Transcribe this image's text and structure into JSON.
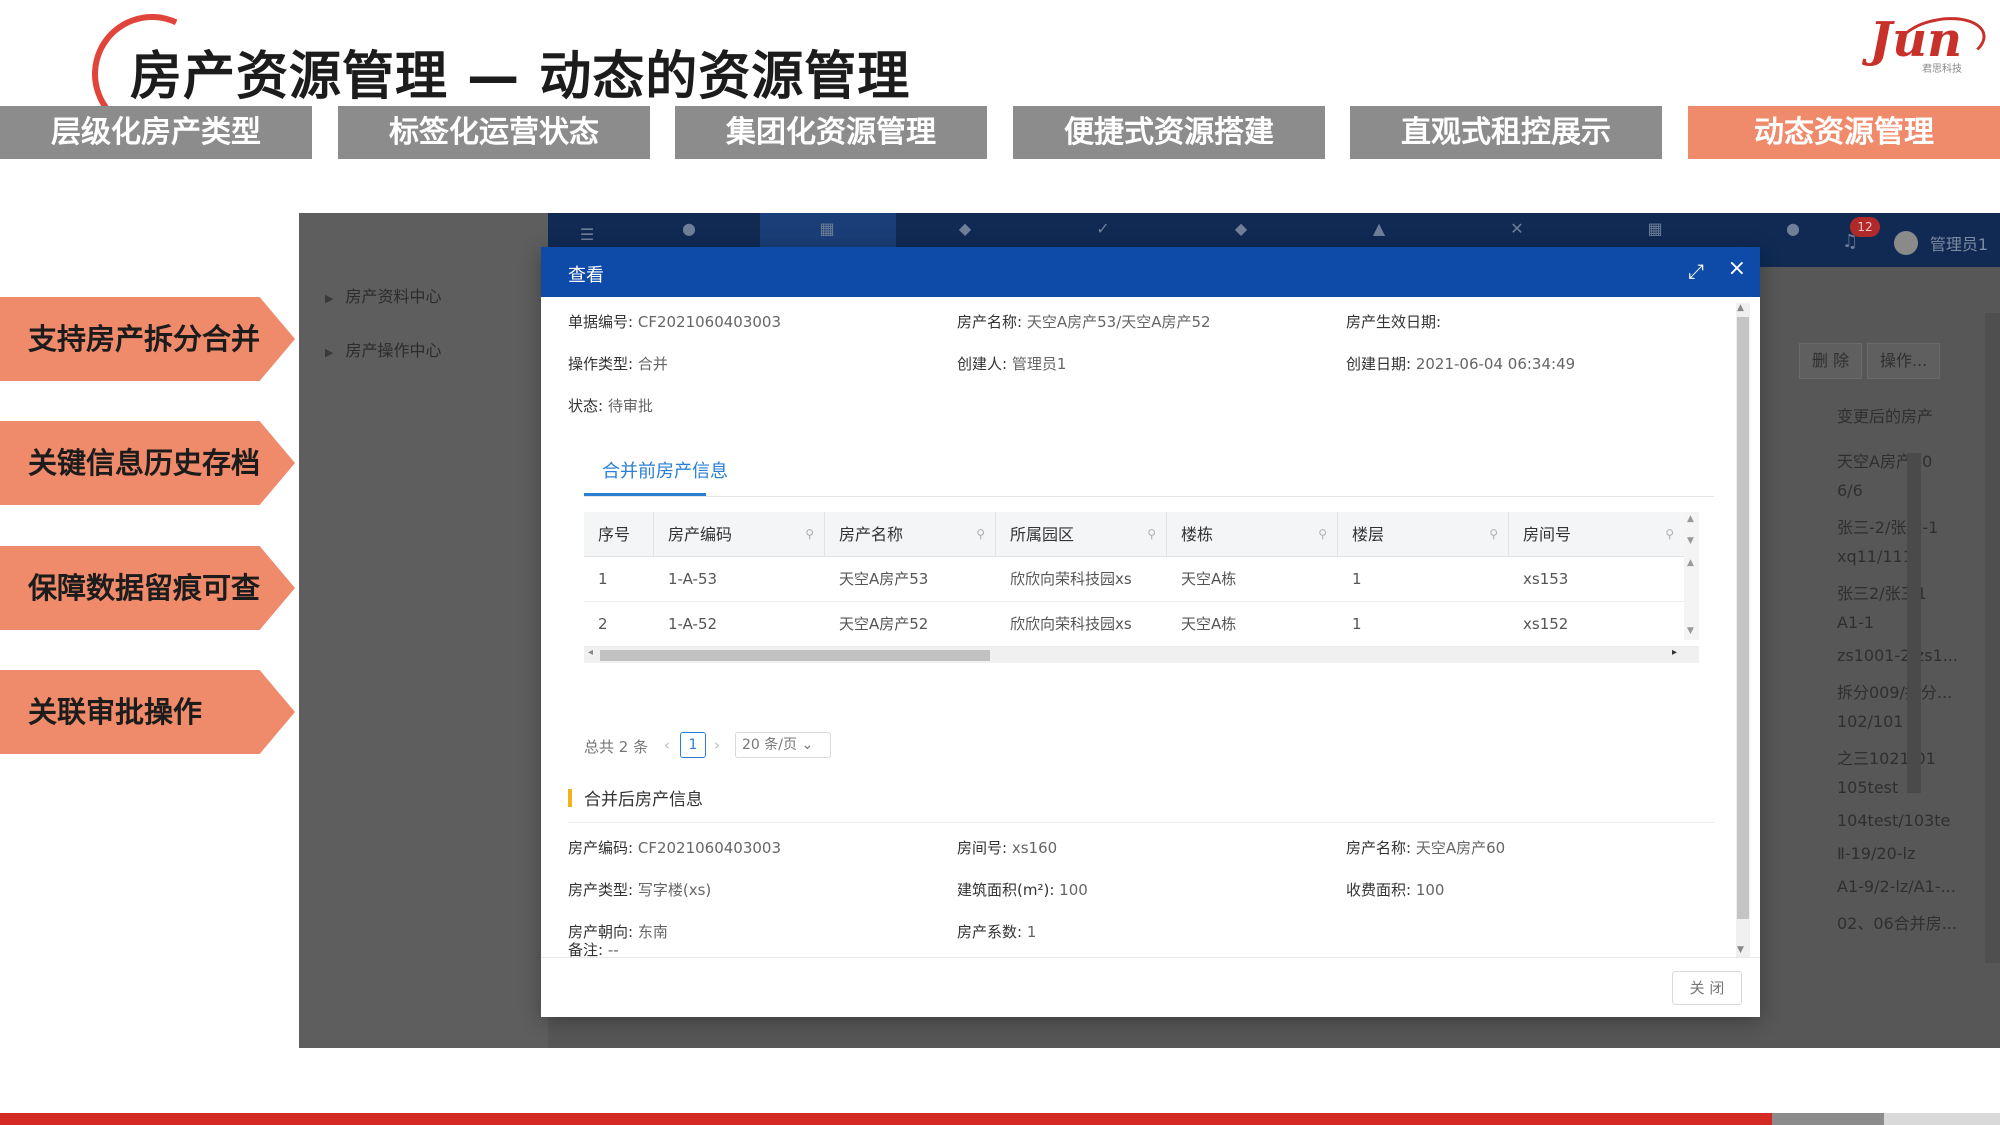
{
  "page_title": "房产资源管理 — 动态的资源管理",
  "logo": {
    "text": "Jun",
    "sub": "君思科技"
  },
  "category_tabs": [
    {
      "label": "层级化房产类型"
    },
    {
      "label": "标签化运营状态"
    },
    {
      "label": "集团化资源管理"
    },
    {
      "label": "便捷式资源搭建"
    },
    {
      "label": "直观式租控展示"
    },
    {
      "label": "动态资源管理",
      "active": true
    }
  ],
  "features": [
    {
      "label": "支持房产拆分合并"
    },
    {
      "label": "关键信息历史存档"
    },
    {
      "label": "保障数据留痕可查"
    },
    {
      "label": "关联审批操作"
    }
  ],
  "background_app": {
    "tree": [
      {
        "label": "房产资料中心"
      },
      {
        "label": "房产操作中心"
      }
    ],
    "notification_count": "12",
    "user": "管理员1",
    "buttons": [
      {
        "label": "删 除"
      },
      {
        "label": "操作..."
      }
    ],
    "right_column_header": "变更后的房产",
    "right_column_values": [
      "天空A房产60",
      "6/6",
      "张三-2/张三-1",
      "xq11/111",
      "张三2/张三1",
      "A1-1",
      "zs1001-2/zs1...",
      "拆分009/拆分...",
      "102/101",
      "之三1021-01",
      "105test",
      "104test/103te",
      "Ⅱ-19/20-lz",
      "A1-9/2-lz/A1-...",
      "02、06合并房..."
    ]
  },
  "modal": {
    "title": "查看",
    "info": {
      "doc_no_label": "单据编号:",
      "doc_no": "CF2021060403003",
      "prop_name_label": "房产名称:",
      "prop_name": "天空A房产53/天空A房产52",
      "effective_label": "房产生效日期:",
      "effective": "",
      "op_type_label": "操作类型:",
      "op_type": "合并",
      "creator_label": "创建人:",
      "creator": "管理员1",
      "created_label": "创建日期:",
      "created": "2021-06-04 06:34:49",
      "status_label": "状态:",
      "status": "待审批"
    },
    "subtab": "合并前房产信息",
    "table": {
      "headers": [
        "序号",
        "房产编码",
        "房产名称",
        "所属园区",
        "楼栋",
        "楼层",
        "房间号"
      ],
      "rows": [
        [
          "1",
          "1-A-53",
          "天空A房产53",
          "欣欣向荣科技园xs",
          "天空A栋",
          "1",
          "xs153"
        ],
        [
          "2",
          "1-A-52",
          "天空A房产52",
          "欣欣向荣科技园xs",
          "天空A栋",
          "1",
          "xs152"
        ]
      ]
    },
    "pager": {
      "total": "总共 2 条",
      "page": "1",
      "page_size": "20 条/页"
    },
    "after_section": "合并后房产信息",
    "after": {
      "code_label": "房产编码:",
      "code": "CF2021060403003",
      "room_label": "房间号:",
      "room": "xs160",
      "name_label": "房产名称:",
      "name": "天空A房产60",
      "type_label": "房产类型:",
      "type": "写字楼(xs)",
      "area_label": "建筑面积(m²):",
      "area": "100",
      "fee_area_label": "收费面积:",
      "fee_area": "100",
      "orient_label": "房产朝向:",
      "orient": "东南",
      "coef_label": "房产系数:",
      "coef": "1",
      "remark_label": "备注:",
      "remark": "--"
    },
    "close_button": "关 闭"
  }
}
